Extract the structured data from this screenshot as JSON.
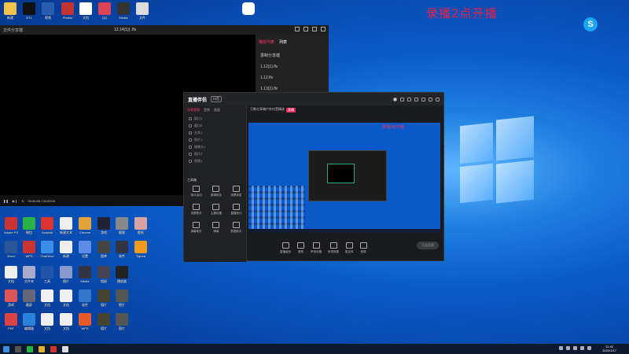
{
  "overlay": {
    "text": "录播2点开播"
  },
  "top_icons": [
    {
      "label": "新建",
      "color": "#f3c24b"
    },
    {
      "label": "BT1",
      "color": "#111111"
    },
    {
      "label": "视频",
      "color": "#2a5db0"
    },
    {
      "label": "Photos",
      "color": "#c23434"
    },
    {
      "label": "文档",
      "color": "#ffffff"
    },
    {
      "label": "QQ",
      "color": "#dd4455"
    },
    {
      "label": "Media",
      "color": "#333333"
    },
    {
      "label": "文件",
      "color": "#dddddd"
    }
  ],
  "player": {
    "title_left": "文件分享端",
    "title_center": "12.14(1)) .flv",
    "side_tabs": [
      "播放列表",
      "列表"
    ],
    "side_rows": [
      {
        "name": "录制分享端",
        "action": "",
        "size": ""
      },
      {
        "name": "1.12(1).flv",
        "action": "",
        "size": ""
      },
      {
        "name": "1.12.flv",
        "action": "",
        "size": ""
      },
      {
        "name": "1.13(1).flv",
        "action": "",
        "size": ""
      }
    ],
    "time": "00:00:00 / 00:00:00"
  },
  "app": {
    "brand": "直播伴侣",
    "brand_badge": "抖音",
    "left_tabs": [
      "场景管理",
      "音效",
      "画面"
    ],
    "scenes": [
      "窗口1",
      "窗口2",
      "文本1",
      "图片1",
      "摄像头1",
      "图片2",
      "视频1"
    ],
    "tools_title": "工具箱",
    "tools": [
      "观众活动",
      "赛事助手",
      "投票信息",
      "录屏助手",
      "主题设置",
      "直播统计",
      "弹幕助手",
      "弹幕",
      "数据助手"
    ],
    "room_title": "万象分享端户外抖音精选",
    "live_badge": "直播",
    "preview_rec": "录播2点开播",
    "bottom_tools": [
      "直播装扮",
      "美颜",
      "声音设置",
      "转场效果",
      "麦克风",
      "音频"
    ],
    "start_live": "开始直播",
    "bottom_left_text": "互动玩法、主播任务、主播直播"
  },
  "desktop_icons": [
    {
      "label": "Adobe PS",
      "color": "#c33"
    },
    {
      "label": "微信",
      "color": "#2ab345"
    },
    {
      "label": "Acrobat",
      "color": "#d33"
    },
    {
      "label": "新建文本",
      "color": "#eee"
    },
    {
      "label": "Chrome",
      "color": "#e4a23a"
    },
    {
      "label": "游戏",
      "color": "#223"
    },
    {
      "label": "截图",
      "color": "#888"
    },
    {
      "label": "壁纸",
      "color": "#d9a3a3"
    },
    {
      "label": "Word",
      "color": "#2b579a"
    },
    {
      "label": "WPS",
      "color": "#c33"
    },
    {
      "label": "OneDrive",
      "color": "#3a8ee6"
    },
    {
      "label": "新建",
      "color": "#eee"
    },
    {
      "label": "设置",
      "color": "#5b8de8"
    },
    {
      "label": "图库",
      "color": "#444"
    },
    {
      "label": "软件",
      "color": "#334"
    },
    {
      "label": "Typora",
      "color": "#f39a1e"
    },
    {
      "label": "文档",
      "color": "#eee"
    },
    {
      "label": "文件夹",
      "color": "#aac"
    },
    {
      "label": "工具",
      "color": "#2255aa"
    },
    {
      "label": "图片",
      "color": "#8899cc"
    },
    {
      "label": "Media",
      "color": "#334"
    },
    {
      "label": "相册",
      "color": "#445"
    },
    {
      "label": "播放器",
      "color": "#222"
    },
    {
      "label": "游戏",
      "color": "#d55"
    },
    {
      "label": "截屏",
      "color": "#667"
    },
    {
      "label": "文档",
      "color": "#eee"
    },
    {
      "label": "文档",
      "color": "#eee"
    },
    {
      "label": "软件",
      "color": "#3377cc"
    },
    {
      "label": "相片",
      "color": "#443"
    },
    {
      "label": "图片",
      "color": "#555"
    },
    {
      "label": "PDF",
      "color": "#d44"
    },
    {
      "label": "编辑器",
      "color": "#2a82da"
    },
    {
      "label": "文档",
      "color": "#eee"
    },
    {
      "label": "文档",
      "color": "#eee"
    },
    {
      "label": "WPS",
      "color": "#e85a2a"
    },
    {
      "label": "相片",
      "color": "#443"
    },
    {
      "label": "图片",
      "color": "#555"
    }
  ],
  "taskbar": {
    "time": "11:42",
    "date": "2022/1/17"
  }
}
